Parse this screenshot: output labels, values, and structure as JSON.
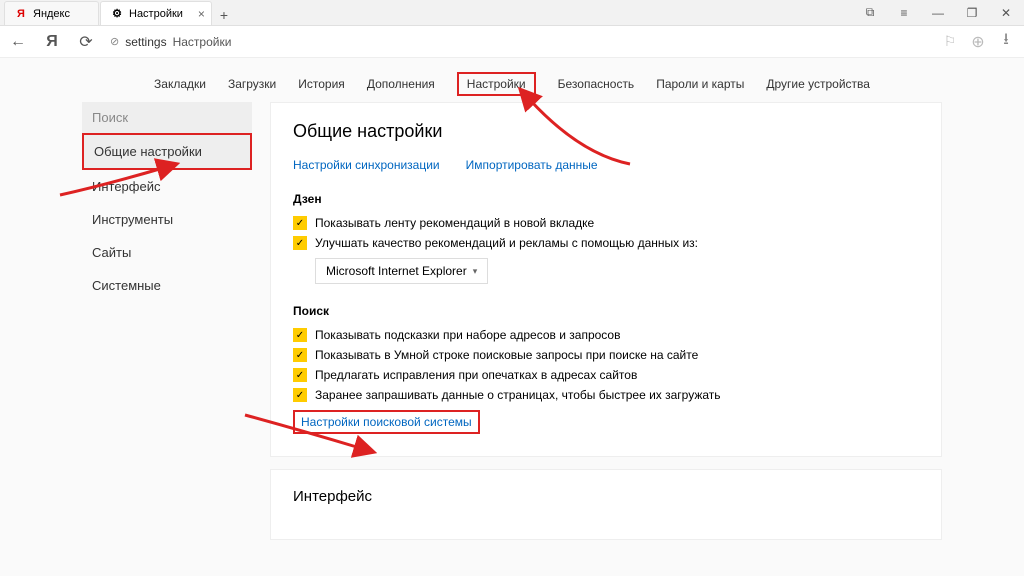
{
  "titlebar": {
    "tabs": [
      {
        "fav": "Я",
        "label": "Яндекс"
      },
      {
        "fav": "⚙",
        "label": "Настройки"
      }
    ]
  },
  "window": {
    "collapse": "⧉",
    "menu": "≡",
    "min": "—",
    "max": "❐",
    "close": "✕"
  },
  "toolbar": {
    "back": "←",
    "ya": "Я",
    "reload": "⟳",
    "lock": "⊘",
    "host": "settings",
    "path": "Настройки",
    "fav": "★",
    "globe": "●",
    "dl": "⭳"
  },
  "topnav": [
    "Закладки",
    "Загрузки",
    "История",
    "Дополнения",
    "Настройки",
    "Безопасность",
    "Пароли и карты",
    "Другие устройства"
  ],
  "topnav_active": 4,
  "sidebar": {
    "search": "Поиск",
    "items": [
      "Общие настройки",
      "Интерфейс",
      "Инструменты",
      "Сайты",
      "Системные"
    ],
    "active": 0
  },
  "panel": {
    "title": "Общие настройки",
    "links": [
      "Настройки синхронизации",
      "Импортировать данные"
    ],
    "zen": {
      "title": "Дзен",
      "items": [
        "Показывать ленту рекомендаций в новой вкладке",
        "Улучшать качество рекомендаций и рекламы с помощью данных из:"
      ],
      "select": "Microsoft Internet Explorer"
    },
    "search": {
      "title": "Поиск",
      "items": [
        "Показывать подсказки при наборе адресов и запросов",
        "Показывать в Умной строке поисковые запросы при поиске на сайте",
        "Предлагать исправления при опечатках в адресах сайтов",
        "Заранее запрашивать данные о страницах, чтобы быстрее их загружать"
      ],
      "link": "Настройки поисковой системы"
    },
    "interface_title": "Интерфейс"
  }
}
